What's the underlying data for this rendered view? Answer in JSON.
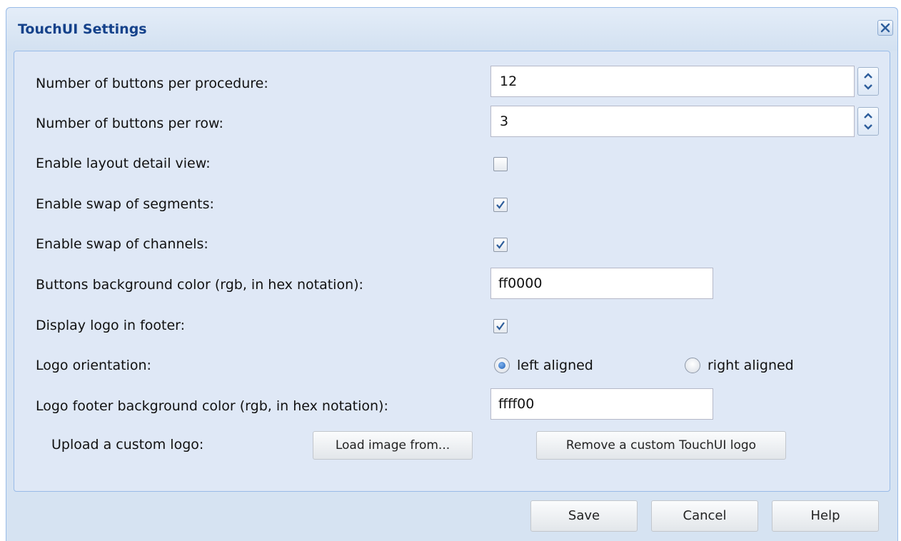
{
  "window": {
    "title": "TouchUI Settings"
  },
  "form": {
    "buttons_per_procedure": {
      "label": "Number of buttons per procedure:",
      "value": "12"
    },
    "buttons_per_row": {
      "label": "Number of buttons per row:",
      "value": "3"
    },
    "layout_detail_view": {
      "label": "Enable layout detail view:",
      "checked": false
    },
    "swap_segments": {
      "label": "Enable swap of segments:",
      "checked": true
    },
    "swap_channels": {
      "label": "Enable swap of channels:",
      "checked": true
    },
    "buttons_bg_color": {
      "label": "Buttons background color (rgb, in hex notation):",
      "value": "ff0000"
    },
    "display_logo": {
      "label": "Display logo in footer:",
      "checked": true
    },
    "logo_orientation": {
      "label": "Logo orientation:",
      "options": [
        "left aligned",
        "right aligned"
      ],
      "selected": "left aligned"
    },
    "logo_footer_bg_color": {
      "label": "Logo footer background color (rgb, in hex notation):",
      "value": "ffff00"
    },
    "upload_logo": {
      "label": "Upload a custom logo:",
      "load_button": "Load image from...",
      "remove_button": "Remove a custom TouchUI logo"
    }
  },
  "footer": {
    "save": "Save",
    "cancel": "Cancel",
    "help": "Help"
  },
  "colors": {
    "title": "#15428b",
    "panel": "#dfe8f6",
    "border": "#99bbe8"
  }
}
